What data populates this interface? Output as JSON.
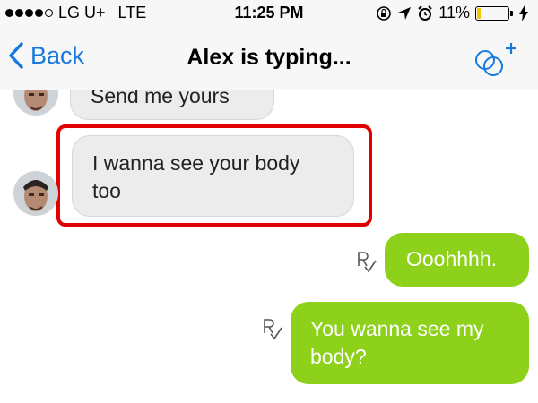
{
  "status_bar": {
    "carrier": "LG U+",
    "network": "LTE",
    "time": "11:25 PM",
    "battery": "11%",
    "icons": [
      "signal-dots-icon",
      "rotation-lock-icon",
      "location-arrow-icon",
      "alarm-icon",
      "battery-icon",
      "charging-bolt-icon"
    ]
  },
  "nav": {
    "back_label": "Back",
    "title": "Alex is typing..."
  },
  "messages": [
    {
      "direction": "incoming",
      "text": "Send me yours"
    },
    {
      "direction": "incoming",
      "text": "I wanna see your body too",
      "highlighted": true
    },
    {
      "direction": "outgoing",
      "text": "Ooohhhh.",
      "receipt": "read"
    },
    {
      "direction": "outgoing",
      "text": "You wanna see my body?",
      "receipt": "read"
    }
  ],
  "colors": {
    "accent": "#1679e0",
    "outgoing_bubble": "#8dd11b",
    "incoming_bubble": "#ececed",
    "highlight": "#e10000",
    "battery_fill": "#f5c400"
  }
}
